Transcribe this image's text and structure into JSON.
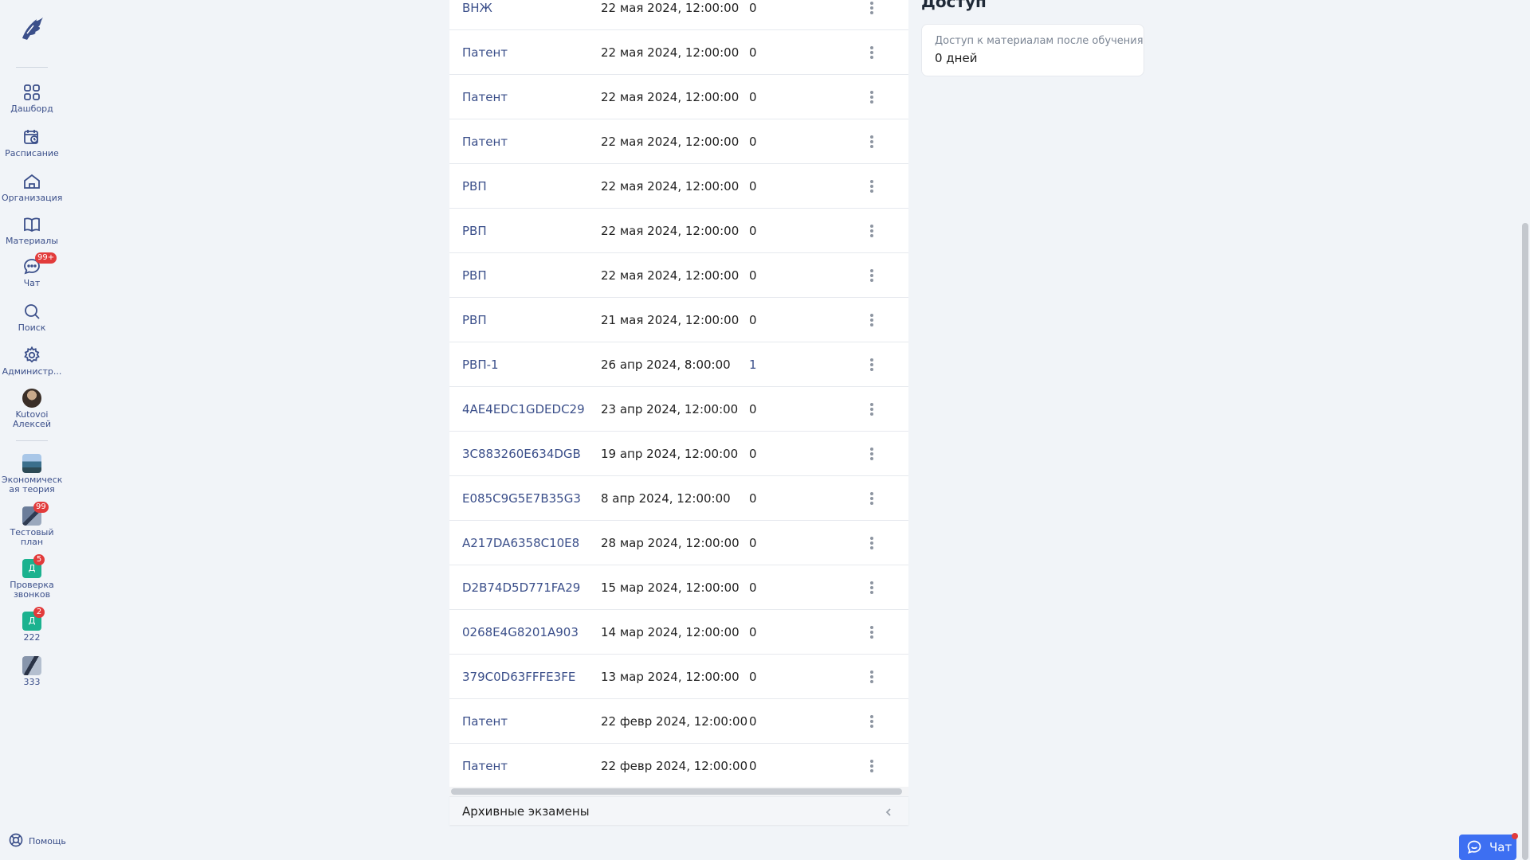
{
  "sidebar": {
    "nav": [
      {
        "label": "Дашборд",
        "icon": "dashboard-grid-icon"
      },
      {
        "label": "Расписание",
        "icon": "calendar-clock-icon"
      },
      {
        "label": "Организация",
        "icon": "organization-home-icon"
      },
      {
        "label": "Материалы",
        "icon": "book-open-icon"
      },
      {
        "label": "Чат",
        "icon": "chat-bubble-icon",
        "badge": "99+"
      },
      {
        "label": "Поиск",
        "icon": "search-icon"
      },
      {
        "label": "Администр...",
        "icon": "gear-icon"
      }
    ],
    "user": {
      "label": "Kutovoi Алексей"
    },
    "courses": [
      {
        "label": "Экономическ ая теория"
      },
      {
        "label": "Тестовый план",
        "badge": "99"
      },
      {
        "label": "Проверка звонков",
        "badge": "5",
        "letter": "Д"
      },
      {
        "label": "222",
        "badge": "2",
        "letter": "Д"
      },
      {
        "label": "333"
      }
    ],
    "help_label": "Помощь"
  },
  "exams": {
    "rows": [
      {
        "name": "ВНЖ",
        "date": "22 мая 2024, 12:00:00",
        "count": "0"
      },
      {
        "name": "Патент",
        "date": "22 мая 2024, 12:00:00",
        "count": "0"
      },
      {
        "name": "Патент",
        "date": "22 мая 2024, 12:00:00",
        "count": "0"
      },
      {
        "name": "Патент",
        "date": "22 мая 2024, 12:00:00",
        "count": "0"
      },
      {
        "name": "РВП",
        "date": "22 мая 2024, 12:00:00",
        "count": "0"
      },
      {
        "name": "РВП",
        "date": "22 мая 2024, 12:00:00",
        "count": "0"
      },
      {
        "name": "РВП",
        "date": "22 мая 2024, 12:00:00",
        "count": "0"
      },
      {
        "name": "РВП",
        "date": "21 мая 2024, 12:00:00",
        "count": "0"
      },
      {
        "name": "РВП-1",
        "date": "26 апр 2024, 8:00:00",
        "count": "1"
      },
      {
        "name": "4AE4EDC1GDEDC29",
        "date": "23 апр 2024, 12:00:00",
        "count": "0"
      },
      {
        "name": "3C883260E634DGB",
        "date": "19 апр 2024, 12:00:00",
        "count": "0"
      },
      {
        "name": "E085C9G5E7B35G3",
        "date": "8 апр 2024, 12:00:00",
        "count": "0"
      },
      {
        "name": "A217DA6358C10E8",
        "date": "28 мар 2024, 12:00:00",
        "count": "0"
      },
      {
        "name": "D2B74D5D771FA29",
        "date": "15 мар 2024, 12:00:00",
        "count": "0"
      },
      {
        "name": "0268E4G8201A903",
        "date": "14 мар 2024, 12:00:00",
        "count": "0"
      },
      {
        "name": "379C0D63FFFE3FE",
        "date": "13 мар 2024, 12:00:00",
        "count": "0"
      },
      {
        "name": "Патент",
        "date": "22 февр 2024, 12:00:00",
        "count": "0"
      },
      {
        "name": "Патент",
        "date": "22 февр 2024, 12:00:00",
        "count": "0"
      }
    ],
    "archived_label": "Архивные экзамены"
  },
  "access": {
    "title": "Доступ",
    "card_label": "Доступ к материалам после обучения",
    "card_value": "0 дней"
  },
  "chat_widget": {
    "label": "Чат"
  },
  "colors": {
    "accent": "#3b4f8a",
    "badge": "#e23b3b",
    "chat_widget": "#3d6ff2",
    "background": "#f1f4f8"
  }
}
